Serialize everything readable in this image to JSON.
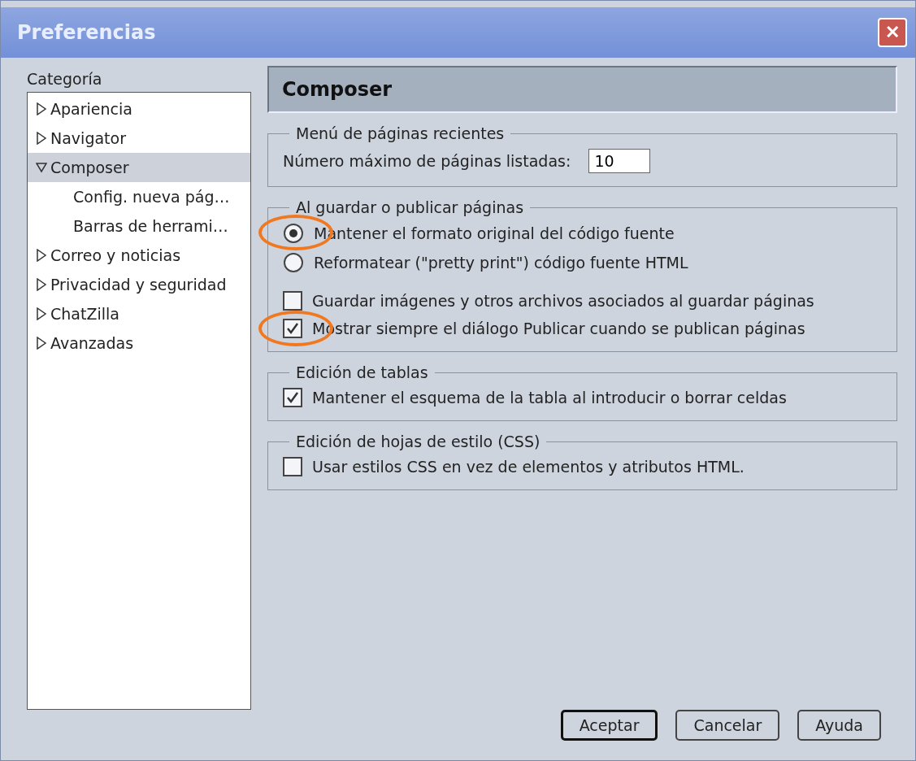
{
  "window": {
    "title": "Preferencias",
    "close": "✕"
  },
  "sidebar": {
    "label": "Categoría",
    "items": [
      {
        "label": "Apariencia",
        "expanded": false,
        "selected": false
      },
      {
        "label": "Navigator",
        "expanded": false,
        "selected": false
      },
      {
        "label": "Composer",
        "expanded": true,
        "selected": true,
        "children": [
          {
            "label": "Config. nueva pág…",
            "selected": false
          },
          {
            "label": "Barras de herrami…",
            "selected": false
          }
        ]
      },
      {
        "label": "Correo y noticias",
        "expanded": false,
        "selected": false
      },
      {
        "label": "Privacidad y seguridad",
        "expanded": false,
        "selected": false
      },
      {
        "label": "ChatZilla",
        "expanded": false,
        "selected": false
      },
      {
        "label": "Avanzadas",
        "expanded": false,
        "selected": false
      }
    ]
  },
  "panel": {
    "title": "Composer",
    "groups": [
      {
        "legend": "Menú de páginas recientes",
        "rows": [
          {
            "kind": "field",
            "label": "Número máximo de páginas listadas:",
            "value": "10"
          }
        ]
      },
      {
        "legend": "Al guardar o publicar páginas",
        "rows": [
          {
            "kind": "radio",
            "label": "Mantener el formato original del código fuente",
            "selected": true,
            "highlighted": true
          },
          {
            "kind": "radio",
            "label": "Reformatear (\"pretty print\") código fuente HTML",
            "selected": false,
            "highlighted": false
          },
          {
            "kind": "checkbox",
            "label": "Guardar imágenes y otros archivos asociados al guardar páginas",
            "checked": false,
            "highlighted": false
          },
          {
            "kind": "checkbox",
            "label": "Mostrar siempre el diálogo Publicar cuando se publican páginas",
            "checked": true,
            "highlighted": true
          }
        ]
      },
      {
        "legend": "Edición de tablas",
        "rows": [
          {
            "kind": "checkbox",
            "label": "Mantener el esquema de la tabla al introducir o borrar celdas",
            "checked": true,
            "highlighted": false
          }
        ]
      },
      {
        "legend": "Edición de hojas de estilo (CSS)",
        "rows": [
          {
            "kind": "checkbox",
            "label": "Usar estilos CSS en vez de elementos y atributos HTML.",
            "checked": false,
            "highlighted": false
          }
        ]
      }
    ]
  },
  "buttons": [
    {
      "label": "Aceptar",
      "default": true
    },
    {
      "label": "Cancelar",
      "default": false
    },
    {
      "label": "Ayuda",
      "default": false
    }
  ]
}
